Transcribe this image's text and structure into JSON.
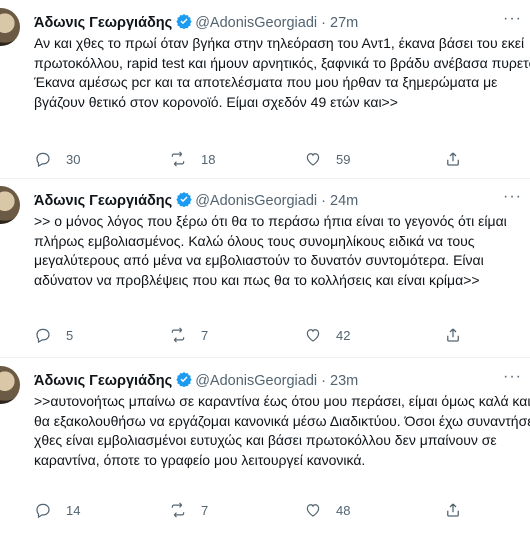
{
  "tweets": [
    {
      "name": "Άδωνις Γεωργιάδης",
      "handle": "@AdonisGeorgiadi",
      "sep": "·",
      "time": "27m",
      "text": "Αν και χθες το πρωί όταν βγήκα στην τηλεόραση του Αντ1, έκανα βάσει του εκεί πρωτοκόλλου, rapid test και ήμουν αρνητικός, ξαφνικά το βράδυ ανέβασα πυρετό. Έκανα αμέσως pcr και τα αποτελέσματα που μου ήρθαν τα ξημερώματα με βγάζουν θετικό στον κορονοϊό. Είμαι σχεδόν 49 ετών και>>",
      "replies": "30",
      "retweets": "18",
      "likes": "59"
    },
    {
      "name": "Άδωνις Γεωργιάδης",
      "handle": "@AdonisGeorgiadi",
      "sep": "·",
      "time": "24m",
      "text": ">> ο μόνος λόγος που ξέρω ότι θα το περάσω ήπια είναι το γεγονός ότι είμαι πλήρως εμβολιασμένος. Καλώ όλους τους συνομηλίκους ειδικά να τους μεγαλύτερους από μένα να εμβολιαστούν το δυνατόν συντομότερα. Είναι αδύνατον να προβλέψεις που και πως θα το κολλήσεις και είναι κρίμα>>",
      "replies": "5",
      "retweets": "7",
      "likes": "42"
    },
    {
      "name": "Άδωνις Γεωργιάδης",
      "handle": "@AdonisGeorgiadi",
      "sep": "·",
      "time": "23m",
      "text": ">>αυτονοήτως μπαίνω σε καραντίνα έως ότου μου περάσει, είμαι όμως καλά και θα εξακολουθήσω να εργάζομαι κανονικά μέσω Διαδικτύου. Όσοι έχω συναντήσει χθες είναι εμβολιασμένοι ευτυχώς και βάσει πρωτοκόλλου δεν μπαίνουν σε καραντίνα, όποτε το γραφείο μου λειτουργεί κανονικά.",
      "replies": "14",
      "retweets": "7",
      "likes": "48"
    }
  ],
  "icons": {
    "verified_color": "#1d9bf0",
    "reply": "reply-icon",
    "retweet": "retweet-icon",
    "like": "heart-icon",
    "share": "share-icon",
    "more": "more-icon"
  },
  "more_glyph": "···"
}
